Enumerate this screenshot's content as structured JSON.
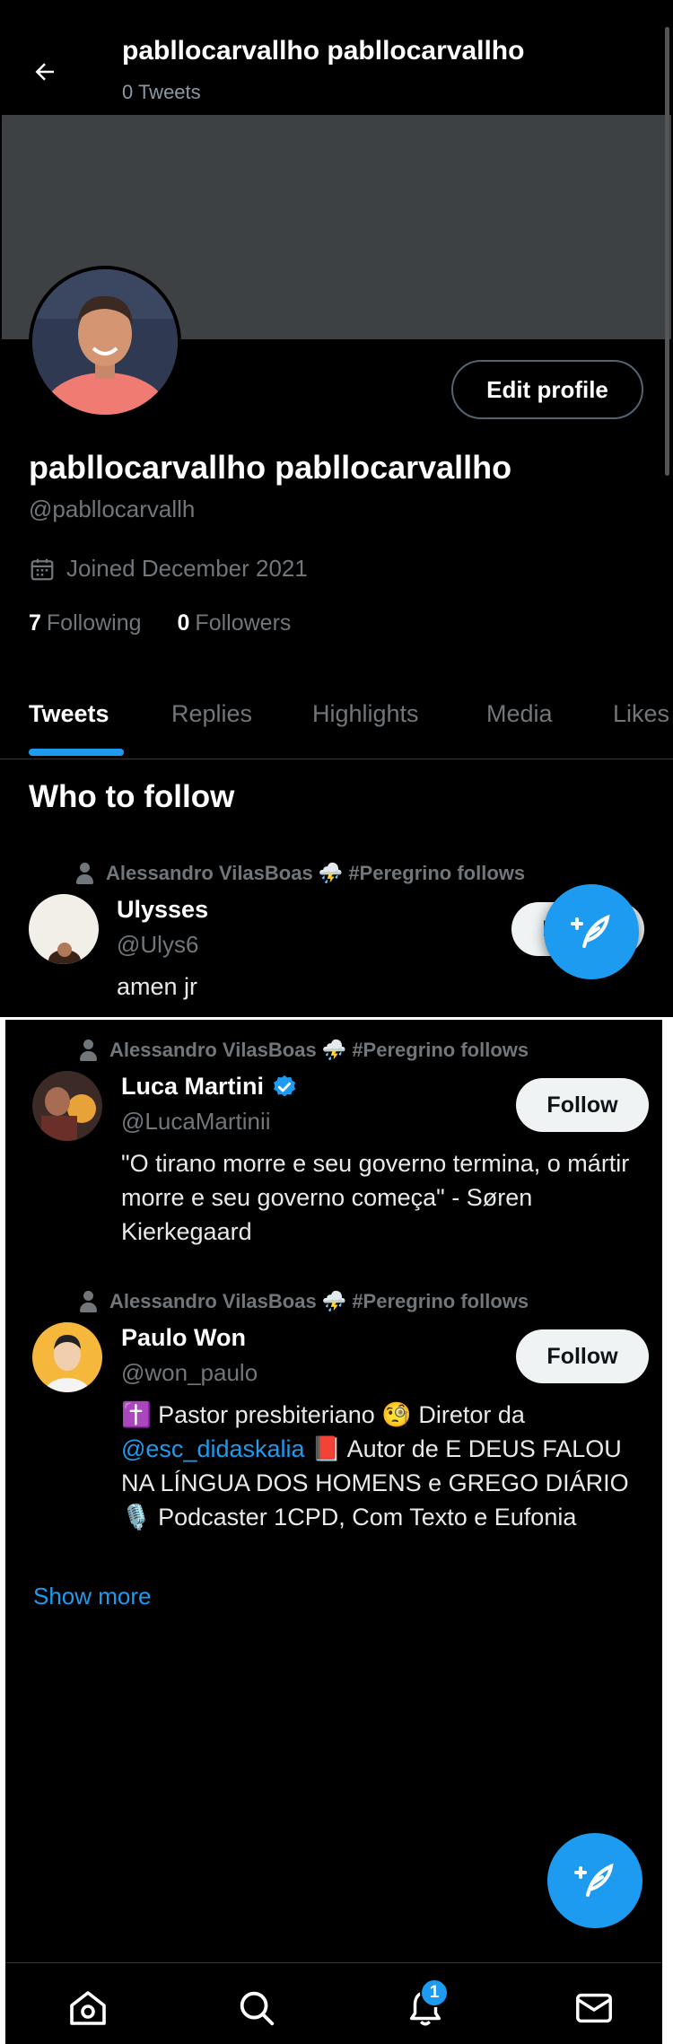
{
  "header": {
    "title": "pabllocarvallho pabllocarvallho",
    "subtitle": "0 Tweets"
  },
  "profile": {
    "edit_button": "Edit profile",
    "name": "pabllocarvallho pabllocarvallho",
    "handle": "@pabllocarvallh",
    "joined": "Joined December 2021",
    "following_count": "7",
    "following_label": "Following",
    "followers_count": "0",
    "followers_label": "Followers"
  },
  "tabs": [
    {
      "label": "Tweets",
      "active": true
    },
    {
      "label": "Replies",
      "active": false
    },
    {
      "label": "Highlights",
      "active": false
    },
    {
      "label": "Media",
      "active": false
    },
    {
      "label": "Likes",
      "active": false
    }
  ],
  "who_to_follow": {
    "title": "Who to follow",
    "suggestions": [
      {
        "social_context": "Alessandro VilasBoas ⛈️ #Peregrino follows",
        "name": "Ulysses",
        "handle": "@Ulys6",
        "bio": "amen jr",
        "follow_label": "Follow",
        "verified": false
      },
      {
        "social_context": "Alessandro VilasBoas ⛈️ #Peregrino follows",
        "name": "Luca Martini",
        "handle": "@LucaMartinii",
        "bio": "\"O tirano morre e seu governo termina, o mártir morre e seu governo começa\" - Søren Kierkegaard",
        "follow_label": "Follow",
        "verified": true
      },
      {
        "social_context": "Alessandro VilasBoas ⛈️ #Peregrino follows",
        "name": "Paulo Won",
        "handle": "@won_paulo",
        "bio_before": "✝️ Pastor presbiteriano 🧐 Diretor da",
        "bio_mention": "@esc_didaskalia",
        "bio_after": "📕 Autor de E DEUS FALOU NA LÍNGUA DOS HOMENS e GREGO DIÁRIO 🎙️ Podcaster 1CPD, Com Texto e Eufonia",
        "follow_label": "Follow",
        "verified": false
      }
    ],
    "show_more": "Show more"
  },
  "bottom_nav": {
    "items": [
      "home-icon",
      "search-icon",
      "notifications-icon",
      "messages-icon"
    ],
    "notifications_badge": "1"
  },
  "colors": {
    "accent": "#1d9bf0",
    "background": "#000000",
    "muted_text": "#71767b",
    "banner": "#3e4144"
  }
}
